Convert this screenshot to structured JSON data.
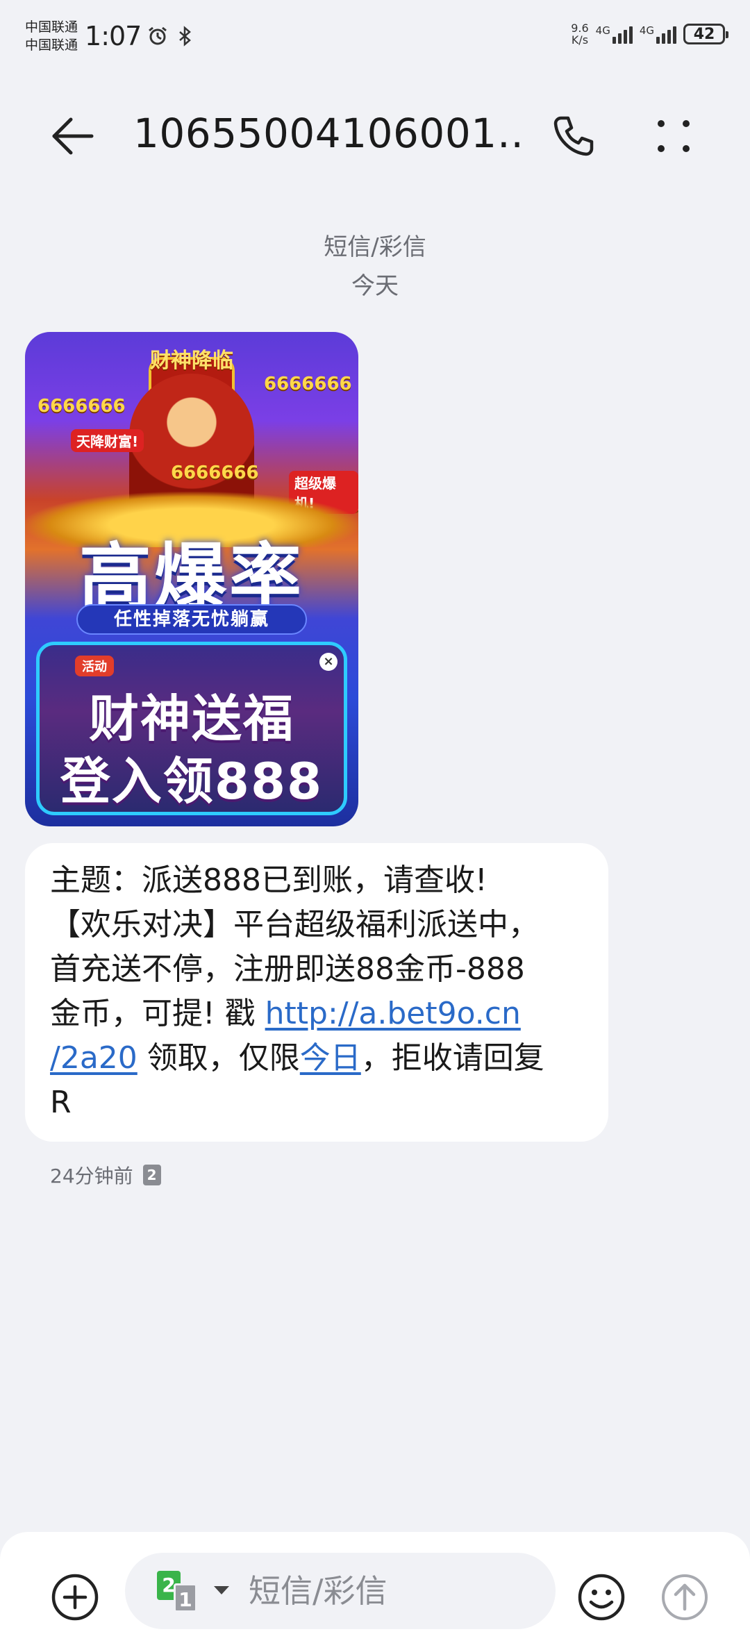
{
  "status_bar": {
    "carrier_1": "中国联通",
    "carrier_2": "中国联通",
    "time": "1:07",
    "speed_value": "9.6",
    "speed_unit": "K/s",
    "net_1": "4G",
    "net_2": "4G",
    "battery": "42",
    "icons": [
      "alarm-icon",
      "bluetooth-icon",
      "signal-icon",
      "battery-icon"
    ]
  },
  "header": {
    "title": "10655004106001…",
    "icons": [
      "back-arrow-icon",
      "phone-icon",
      "more-icon"
    ]
  },
  "conversation": {
    "message_type": "短信/彩信",
    "day_label": "今天"
  },
  "mms_image": {
    "banner_top": "财神降临",
    "coin_text": "6666666",
    "tag_left": "天降财富!",
    "tag_right": "超级爆机!",
    "big_text": "高爆率",
    "sub_text": "任性掉落无忧躺赢",
    "panel_tag": "活动",
    "panel_close": "×",
    "line_1": "财神送福",
    "line_2": "登入领888"
  },
  "message": {
    "line_1": "主题：派送888已到账，请查收!",
    "line_2": "【欢乐对决】平台超级福利派送中，",
    "line_3": "首充送不停，注册即送88金币-888",
    "line_4_pre": "金币，可提! 戳 ",
    "link_part_1": "http://a.bet9o.cn",
    "link_part_2": "/2a20",
    "line_5_mid": " 领取，仅限",
    "link_today": "今日",
    "line_5_post": "，拒收请回复",
    "line_6": "R",
    "time_ago": "24分钟前",
    "sim": "2"
  },
  "composer": {
    "placeholder": "短信/彩信",
    "sim_primary": "2",
    "sim_secondary": "1",
    "icons": [
      "add-icon",
      "sim-switch-icon",
      "emoji-icon",
      "send-icon"
    ]
  }
}
